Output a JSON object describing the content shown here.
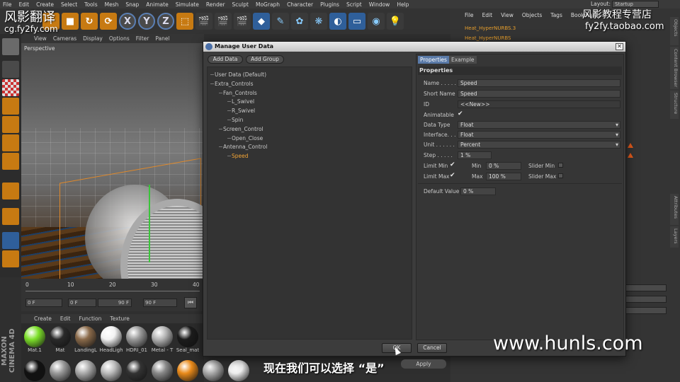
{
  "menubar": {
    "items": [
      "File",
      "Edit",
      "Create",
      "Select",
      "Tools",
      "Mesh",
      "Snap",
      "Animate",
      "Simulate",
      "Render",
      "Sculpt",
      "MoGraph",
      "Character",
      "Plugins",
      "Script",
      "Window",
      "Help"
    ],
    "layout_label": "Layout:",
    "layout_value": "Startup"
  },
  "toolbar": {
    "axis_x": "X",
    "axis_y": "Y",
    "axis_z": "Z"
  },
  "viewport": {
    "menu": [
      "View",
      "Cameras",
      "Display",
      "Options",
      "Filter",
      "Panel"
    ],
    "label": "Perspective"
  },
  "timeline": {
    "ticks": [
      "0",
      "10",
      "20",
      "30",
      "40"
    ],
    "start": "0 F",
    "current": "0 F",
    "end_a": "90 F",
    "end_b": "90 F"
  },
  "materials": {
    "menu": [
      "Create",
      "Edit",
      "Function",
      "Texture"
    ],
    "items": [
      {
        "name": "Mat.1",
        "color": "#7de02a"
      },
      {
        "name": "Mat",
        "color": "#2a2a2a"
      },
      {
        "name": "LandingL",
        "color": "#8a6a4a"
      },
      {
        "name": "HeadLigh",
        "color": "#f2f2f2"
      },
      {
        "name": "HDRI_01",
        "color": "#9a9a9a"
      },
      {
        "name": "Metal - T",
        "color": "#b5b5b5"
      },
      {
        "name": "Seal_mat",
        "color": "#1c1c1c"
      }
    ],
    "brand": "MAXON CINEMA 4D"
  },
  "object_manager": {
    "menu": [
      "File",
      "Edit",
      "View",
      "Objects",
      "Tags",
      "Bookmarks"
    ],
    "rows": [
      "Heat_HyperNURBS.3",
      "Heat_HyperNURBS"
    ]
  },
  "side_tabs": [
    "Objects",
    "Content Browser",
    "Structure",
    "Attributes",
    "Layers"
  ],
  "watermarks": {
    "top_left": "风影翻译",
    "top_left_sub": "cg.fy2fy.com",
    "top_right": "风影教程专营店",
    "top_right_sub": "fy2fy.taobao.com",
    "bottom_right": "www.hunls.com",
    "subtitle": "现在我们可以选择 “是”"
  },
  "dialog": {
    "title": "Manage User Data",
    "add_data": "Add Data",
    "add_group": "Add Group",
    "tabs": [
      "Properties",
      "Example"
    ],
    "properties_header": "Properties",
    "tree": [
      {
        "label": "User Data (Default)",
        "level": 0,
        "selected": false
      },
      {
        "label": "Extra_Controls",
        "level": 0,
        "selected": false
      },
      {
        "label": "Fan_Controls",
        "level": 1,
        "selected": false
      },
      {
        "label": "L_Swivel",
        "level": 2,
        "selected": false
      },
      {
        "label": "R_Swivel",
        "level": 2,
        "selected": false
      },
      {
        "label": "Spin",
        "level": 2,
        "selected": false
      },
      {
        "label": "Screen_Control",
        "level": 1,
        "selected": false
      },
      {
        "label": "Open_Close",
        "level": 2,
        "selected": false
      },
      {
        "label": "Antenna_Control",
        "level": 1,
        "selected": false
      },
      {
        "label": "Speed",
        "level": 2,
        "selected": true
      }
    ],
    "props": {
      "name_label": "Name . . . . .",
      "name_value": "Speed",
      "short_name_label": "Short Name",
      "short_name_value": "Speed",
      "id_label": "ID",
      "id_value": "<<New>>",
      "animatable_label": "Animatable",
      "animatable_check": "✔",
      "data_type_label": "Data Type",
      "data_type_value": "Float",
      "interface_label": "Interface. . .",
      "interface_value": "Float",
      "unit_label": "Unit . . . . . .",
      "unit_value": "Percent",
      "step_label": "Step . . . . .",
      "step_value": "1 %",
      "limit_min_label": "Limit Min",
      "limit_min_check": "✔",
      "min_label": "Min",
      "min_value": "0 %",
      "slider_min_label": "Slider Min",
      "limit_max_label": "Limit Max",
      "limit_max_check": "✔",
      "max_label": "Max",
      "max_value": "100 %",
      "slider_max_label": "Slider Max",
      "default_label": "Default Value",
      "default_value": "0 %"
    },
    "ok": "OK",
    "cancel": "Cancel"
  },
  "apply": "Apply"
}
